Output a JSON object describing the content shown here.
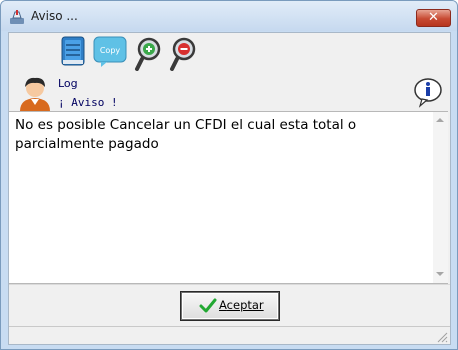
{
  "window": {
    "title": "Aviso ..."
  },
  "toolbar": {
    "copy_icon_text": "Copy"
  },
  "header": {
    "log_label": "Log",
    "aviso_label": "¡ Aviso !"
  },
  "message": {
    "text": "No es posible Cancelar un CFDI el cual esta total o parcialmente pagado"
  },
  "buttons": {
    "accept_label": "Aceptar"
  },
  "icons": {
    "window": "app-icon",
    "close": "close-icon",
    "notes": "notebook-icon",
    "copy": "copy-icon",
    "zoom_in": "zoom-in-icon",
    "zoom_out": "zoom-out-icon",
    "user": "user-avatar-icon",
    "info": "info-icon",
    "accept": "checkmark-icon",
    "grip": "resize-grip-icon"
  }
}
